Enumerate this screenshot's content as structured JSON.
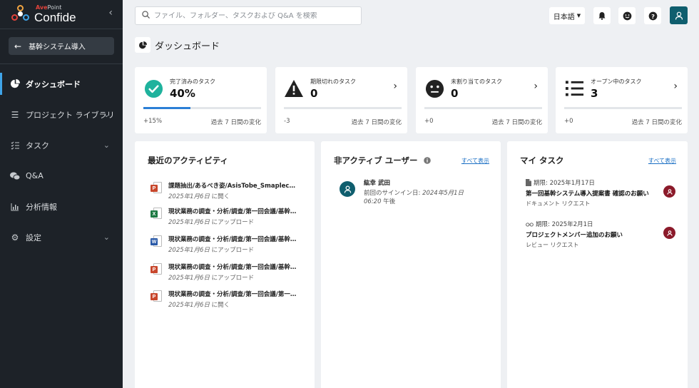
{
  "brand": {
    "vendor_prefix": "Ave",
    "vendor_suffix": "Point",
    "product": "Confide"
  },
  "sidebar": {
    "project_label": "基幹システム導入",
    "items": [
      {
        "label": "ダッシュボード",
        "icon": "pie-chart-icon",
        "active": true
      },
      {
        "label": "プロジェクト ライブラリ",
        "icon": "menu-lines-icon",
        "expandable": true
      },
      {
        "label": "タスク",
        "icon": "checklist-icon",
        "expandable": true
      },
      {
        "label": "Q&A",
        "icon": "chat-bubbles-icon"
      },
      {
        "label": "分析情報",
        "icon": "bar-chart-icon"
      },
      {
        "label": "設定",
        "icon": "gear-icon",
        "expandable": true
      }
    ]
  },
  "header": {
    "search_placeholder": "ファイル、フォルダー、タスクおよび Q&A を検索",
    "language": "日本語"
  },
  "page": {
    "title": "ダッシュボード"
  },
  "stats": [
    {
      "label": "完了済みのタスク",
      "value": "40%",
      "progress": 0.4,
      "delta": "+15%",
      "period": "過去 7 日間の変化",
      "icon": "check-circle-icon",
      "color": "#1fb29d"
    },
    {
      "label": "期限切れのタスク",
      "value": "0",
      "delta": "-3",
      "period": "過去 7 日間の変化",
      "icon": "warning-icon"
    },
    {
      "label": "未割り当てのタスク",
      "value": "0",
      "delta": "+0",
      "period": "過去 7 日間の変化",
      "icon": "neutral-face-icon"
    },
    {
      "label": "オープン中のタスク",
      "value": "3",
      "delta": "+0",
      "period": "過去 7 日間の変化",
      "icon": "list-icon"
    }
  ],
  "activity": {
    "title": "最近のアクティビティ",
    "items": [
      {
        "file": "課題抽出/あるべき姿/AsisTobe_Smaplecsv",
        "date": "2025年1月6日",
        "action": "に開く",
        "type": "ppt"
      },
      {
        "file": "現状業務の調査・分析/調査/第一回会議/基幹システム導入.xlsx",
        "date": "2025年1月6日",
        "action": "にアップロード",
        "type": "xls"
      },
      {
        "file": "現状業務の調査・分析/調査/第一回会議/基幹システム導入.docx",
        "date": "2025年1月6日",
        "action": "にアップロード",
        "type": "doc"
      },
      {
        "file": "現状業務の調査・分析/調査/第一回会議/基幹システム導入.pptx",
        "date": "2025年1月6日",
        "action": "にアップロード",
        "type": "ppt"
      },
      {
        "file": "現状業務の調査・分析/調査/第一回会議/第一回議事録.pptx",
        "date": "2025年1月6日",
        "action": "に開く",
        "type": "ppt"
      }
    ]
  },
  "inactive": {
    "title": "非アクティブ ユーザー",
    "see_all": "すべて表示",
    "user": {
      "name": "紘幸 武田",
      "last_signin_label": "前回のサインイン日:",
      "last_signin_date": "2024年5月1日",
      "time": "06:20",
      "ampm": "午後"
    }
  },
  "my_tasks": {
    "title": "マイ タスク",
    "see_all": "すべて表示",
    "items": [
      {
        "due": "期限: 2025年1月17日",
        "title": "第一回基幹システム導入提案書 確認のお願い",
        "type": "ドキュメント リクエスト",
        "icon": "document-icon"
      },
      {
        "due": "期限: 2025年2月1日",
        "title": "プロジェクトメンバー追加のお願い",
        "type": "レビュー リクエスト",
        "icon": "glasses-icon"
      }
    ]
  },
  "colors": {
    "sidebar": "#1d2228",
    "accent": "#0f5e6e",
    "link": "#1a6fc4",
    "progress": "#2b7fd6",
    "task_avatar": "#8b1a2a"
  }
}
